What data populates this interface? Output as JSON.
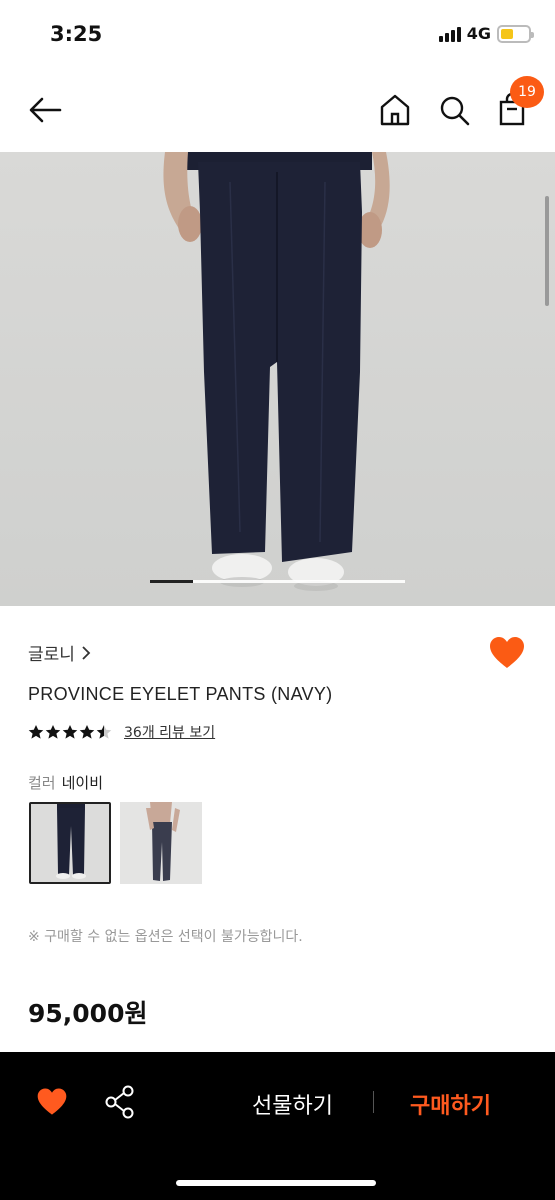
{
  "status_bar": {
    "time": "3:25",
    "network": "4G",
    "battery_level": 0.45,
    "battery_color": "#f5c518"
  },
  "nav": {
    "back_icon": "arrow-left-icon",
    "home_icon": "home-icon",
    "search_icon": "search-icon",
    "cart_icon": "shopping-bag-icon",
    "cart_count": "19"
  },
  "gallery": {
    "slide_index": 1,
    "slide_count": 6
  },
  "product": {
    "brand": "글로니",
    "name": "PROVINCE EYELET PANTS (NAVY)",
    "rating": 4.5,
    "review_link": "36개 리뷰 보기",
    "option_label": "컬러",
    "option_value": "네이비",
    "notice": "※ 구매할 수 없는 옵션은 선택이 불가능합니다.",
    "price": "95,000원",
    "wishlisted": true
  },
  "bottom_bar": {
    "gift_label": "선물하기",
    "buy_label": "구매하기"
  },
  "colors": {
    "accent": "#ff5a1f",
    "badge": "#fb5b14",
    "bottom_bar_bg": "#000000"
  }
}
